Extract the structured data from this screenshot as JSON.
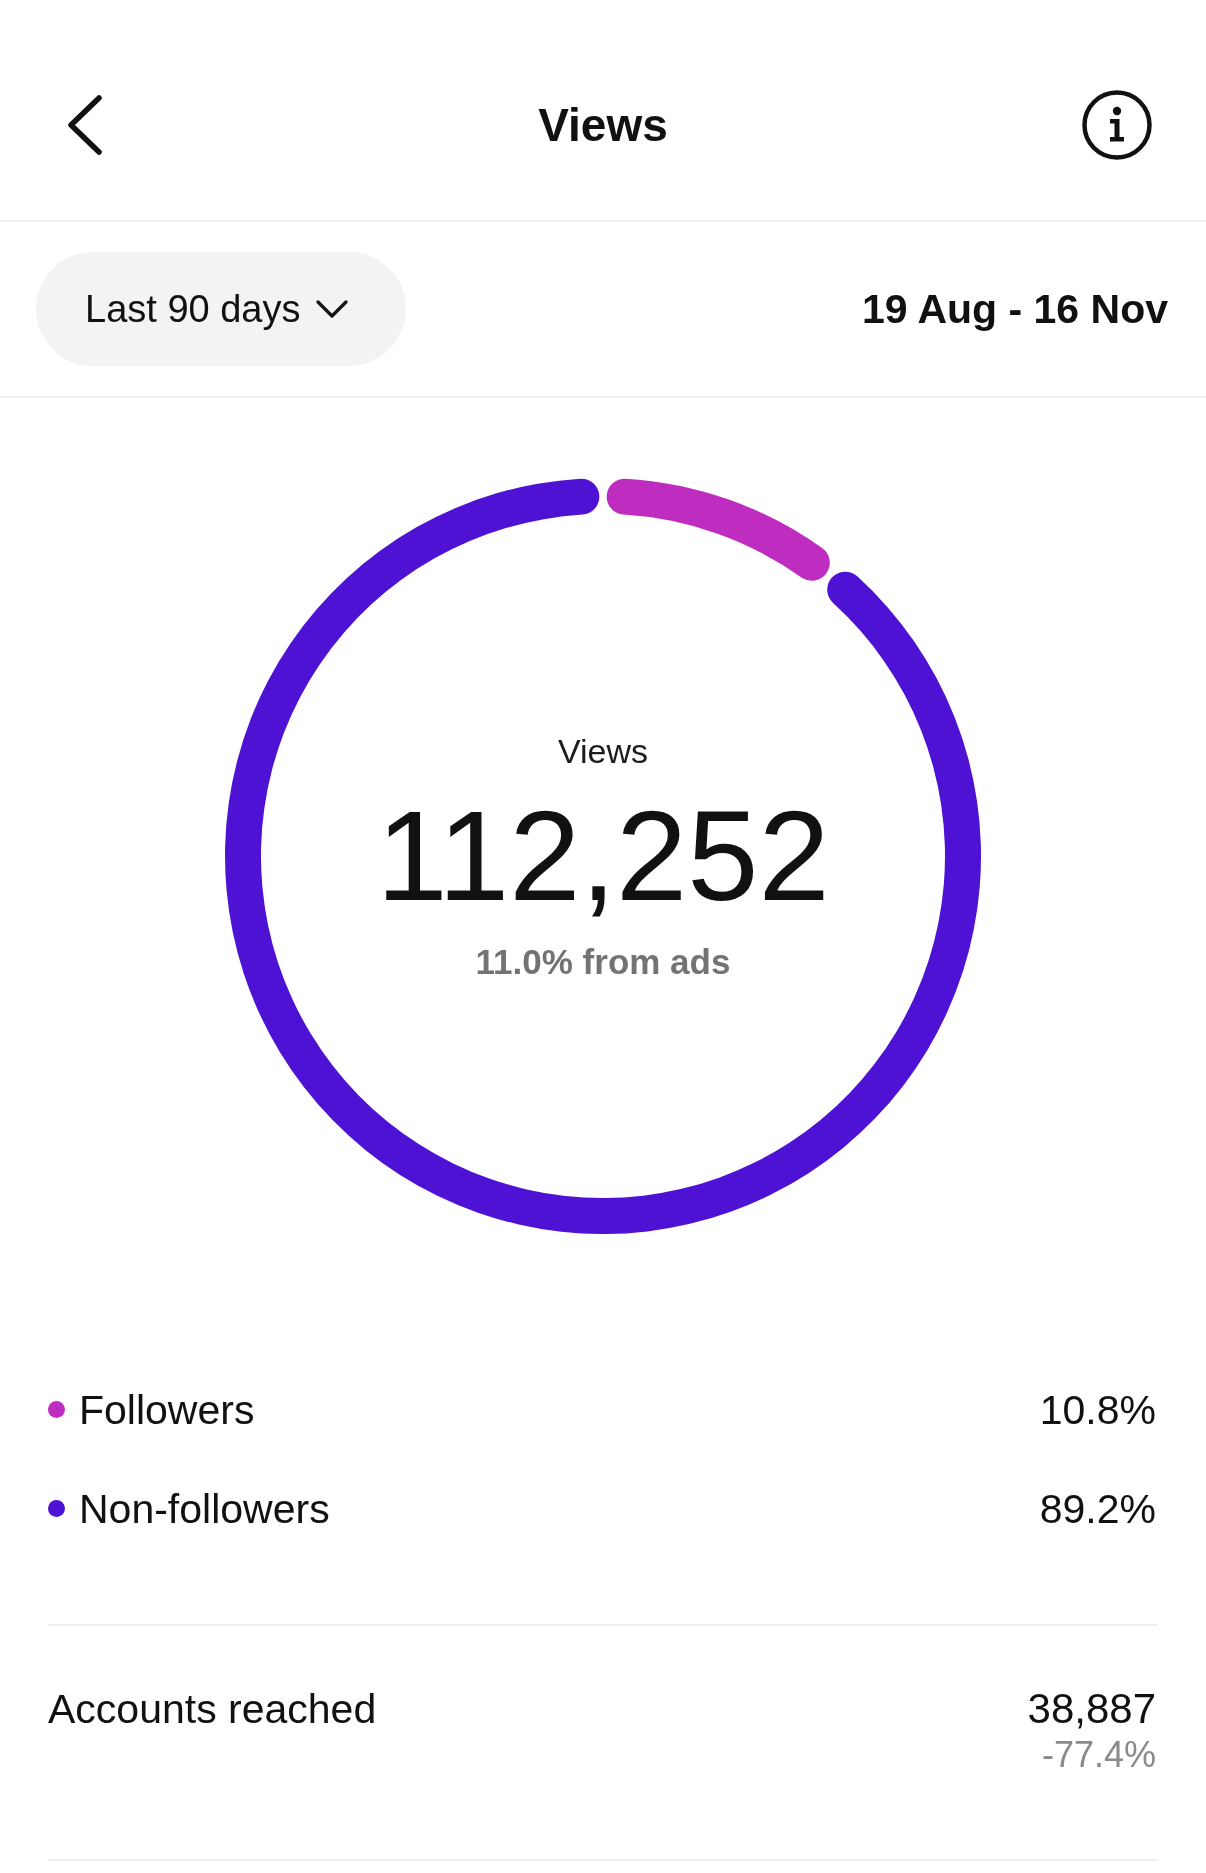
{
  "header": {
    "title": "Views"
  },
  "filter": {
    "period": "Last 90 days",
    "date_range": "19 Aug - 16 Nov"
  },
  "summary": {
    "label": "Views",
    "total": "112,252",
    "ads_share": "11.0% from ads",
    "chart_data": {
      "type": "donut",
      "categories": [
        "Followers",
        "Non-followers"
      ],
      "values": [
        10.8,
        89.2
      ]
    }
  },
  "legend": [
    {
      "value": "10.8%",
      "color": "#bf2dc0"
    },
    {
      "value": "89.2%",
      "color": "#4e12d4"
    }
  ],
  "metrics": [
    {
      "label": "Accounts reached",
      "value": "38,887",
      "change": "-77.4%"
    }
  ]
}
